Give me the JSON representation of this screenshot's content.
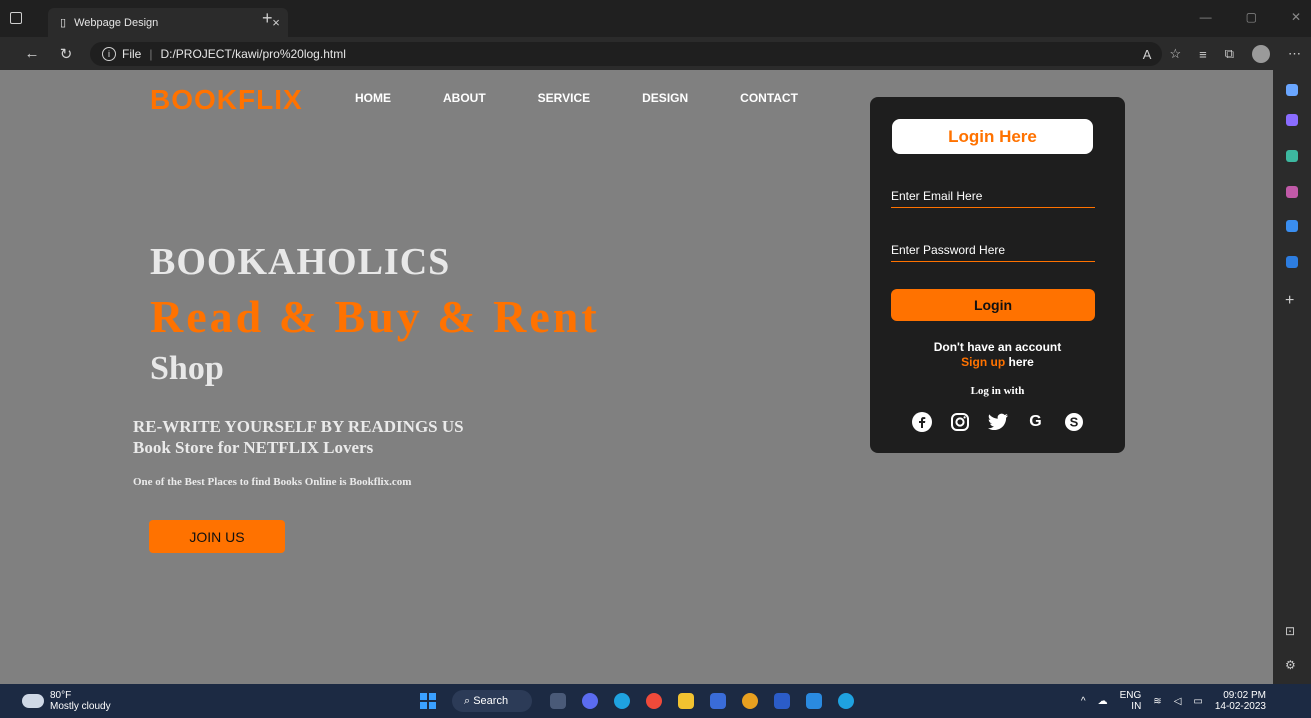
{
  "browser": {
    "tab_title": "Webpage Design",
    "tab_close": "×",
    "new_tab": "+",
    "url_scheme": "File",
    "url_path": "D:/PROJECT/kawi/pro%20log.html",
    "window_controls": [
      "—",
      "▢",
      "✕"
    ]
  },
  "nav": {
    "logo": "BOOKFLIX",
    "links": [
      "HOME",
      "ABOUT",
      "SERVICE",
      "DESIGN",
      "CONTACT"
    ]
  },
  "hero": {
    "title": "BOOKAHOLICS",
    "highlight": "Read & Buy & Rent",
    "shop": "Shop",
    "subtitle1": "RE-WRITE YOURSELF BY READINGS US",
    "subtitle2": "Book Store for NETFLIX Lovers",
    "small_text": "One of the Best Places to find Books Online is Bookflix.com",
    "join_button": "JOIN US"
  },
  "login": {
    "title": "Login Here",
    "email_placeholder": "Enter Email Here",
    "password_placeholder": "Enter Password Here",
    "button": "Login",
    "no_account": "Don't have an account",
    "signup_link": "Sign up",
    "signup_suffix": " here",
    "login_with": "Log in with",
    "socials": [
      "facebook-icon",
      "instagram-icon",
      "twitter-icon",
      "google-icon",
      "skype-icon"
    ]
  },
  "taskbar": {
    "temperature": "80°F",
    "weather": "Mostly cloudy",
    "search": "Search",
    "lang": "ENG",
    "region": "IN",
    "time": "09:02 PM",
    "date": "14-02-2023"
  },
  "colors": {
    "accent": "#ff7200",
    "page_bg": "#808080",
    "card_bg": "#1e1e1e"
  }
}
